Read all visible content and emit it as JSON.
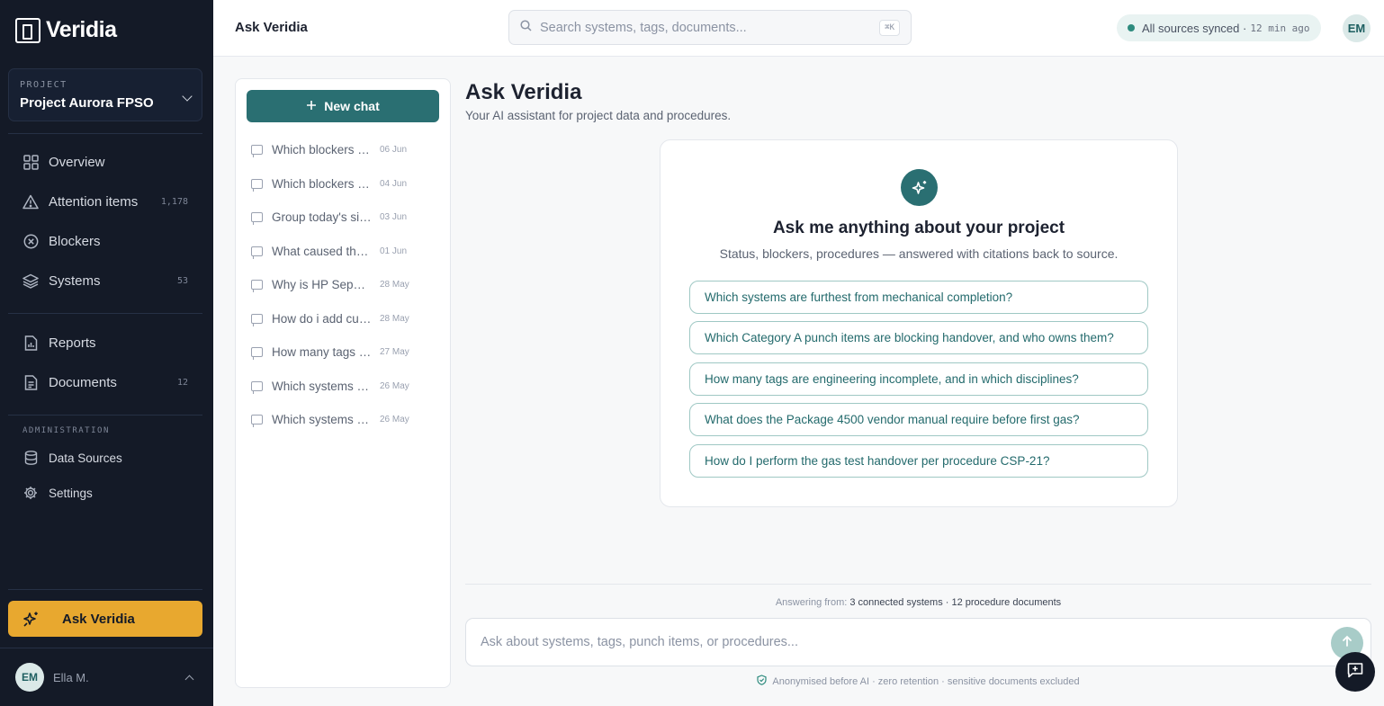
{
  "app": {
    "logo_text": "Veridia"
  },
  "project": {
    "kicker": "PROJECT",
    "name": "Project Aurora FPSO"
  },
  "nav": {
    "main": [
      {
        "label": "Overview",
        "icon": "grid-icon",
        "count": ""
      },
      {
        "label": "Attention items",
        "icon": "warning-triangle-icon",
        "count": "1,178"
      },
      {
        "label": "Blockers",
        "icon": "x-circle-icon",
        "count": ""
      },
      {
        "label": "Systems",
        "icon": "layers-icon",
        "count": "53"
      }
    ],
    "secondary": [
      {
        "label": "Reports",
        "icon": "report-icon",
        "count": ""
      },
      {
        "label": "Documents",
        "icon": "document-icon",
        "count": "12"
      }
    ],
    "admin_label": "ADMINISTRATION",
    "admin": [
      {
        "label": "Data Sources",
        "icon": "database-icon"
      },
      {
        "label": "Settings",
        "icon": "gear-icon"
      }
    ],
    "ask_label": "Ask Veridia"
  },
  "user": {
    "initials": "EM",
    "name": "Ella M."
  },
  "topbar": {
    "title": "Ask Veridia",
    "search_placeholder": "Search systems, tags, documents...",
    "shortcut": "⌘K",
    "sync_text": "All sources synced ·",
    "sync_time": "12 min ago",
    "avatar_initials": "EM"
  },
  "history": {
    "new_chat_label": "New chat",
    "items": [
      {
        "title": "Which blockers are most urgent?",
        "date": "06 Jun"
      },
      {
        "title": "Which blockers affect first gas?",
        "date": "04 Jun"
      },
      {
        "title": "Group today's signed tags",
        "date": "03 Jun"
      },
      {
        "title": "What caused the delay?",
        "date": "01 Jun"
      },
      {
        "title": "Why is HP Separator behind?",
        "date": "28 May"
      },
      {
        "title": "How do i add custom fields?",
        "date": "28 May"
      },
      {
        "title": "How many tags are open?",
        "date": "27 May"
      },
      {
        "title": "Which systems have punch items?",
        "date": "26 May"
      },
      {
        "title": "Which systems are at risk?",
        "date": "26 May"
      }
    ]
  },
  "main": {
    "title": "Ask Veridia",
    "subtitle": "Your AI assistant for project data and procedures.",
    "card_title": "Ask me anything about your project",
    "card_subtitle": "Status, blockers, procedures — answered with citations back to source.",
    "suggestions": [
      "Which systems are furthest from mechanical completion?",
      "Which Category A punch items are blocking handover, and who owns them?",
      "How many tags are engineering incomplete, and in which disciplines?",
      "What does the Package 4500 vendor manual require before first gas?",
      "How do I perform the gas test handover per procedure CSP-21?"
    ],
    "answer_from_label": "Answering from:",
    "answer_from_value": "3 connected systems · 12 procedure documents",
    "composer_placeholder": "Ask about systems, tags, punch items, or procedures...",
    "privacy_note": "Anonymised before AI · zero retention · sensitive documents excluded"
  },
  "colors": {
    "accent": "#2a6f72",
    "highlight": "#e8a82f",
    "sidebar_bg": "#141a27"
  }
}
